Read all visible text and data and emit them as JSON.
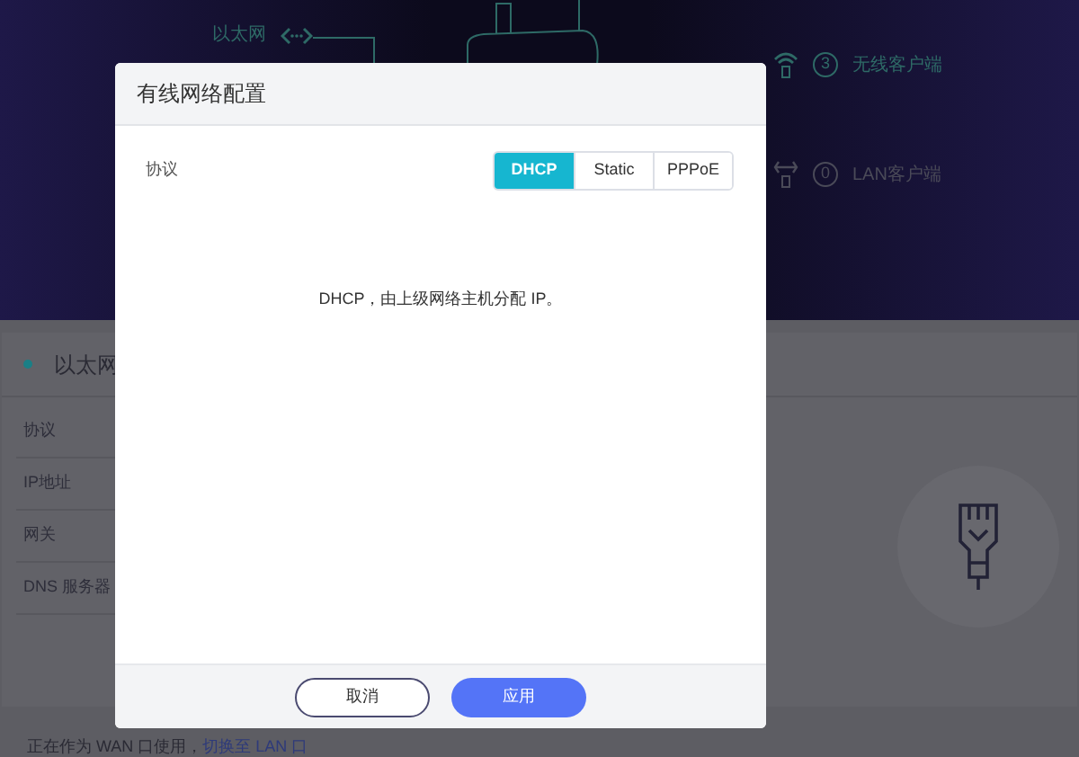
{
  "diagram": {
    "ethernet_label": "以太网",
    "wireless": {
      "count": "3",
      "label": "无线客户端"
    },
    "lan": {
      "count": "0",
      "label": "LAN客户端"
    }
  },
  "card": {
    "title": "以太网",
    "rows": [
      "协议",
      "IP地址",
      "网关",
      "DNS 服务器"
    ],
    "status_text": "正在作为 WAN 口使用，",
    "switch_link": "切换至 LAN 口"
  },
  "dialog": {
    "title": "有线网络配置",
    "field_label": "协议",
    "protocols": [
      {
        "label": "DHCP",
        "selected": true
      },
      {
        "label": "Static",
        "selected": false
      },
      {
        "label": "PPPoE",
        "selected": false
      }
    ],
    "description": "DHCP，由上级网络主机分配 IP。",
    "buttons": [
      {
        "label": "取消",
        "kind": "secondary"
      },
      {
        "label": "应用",
        "kind": "primary"
      }
    ]
  }
}
